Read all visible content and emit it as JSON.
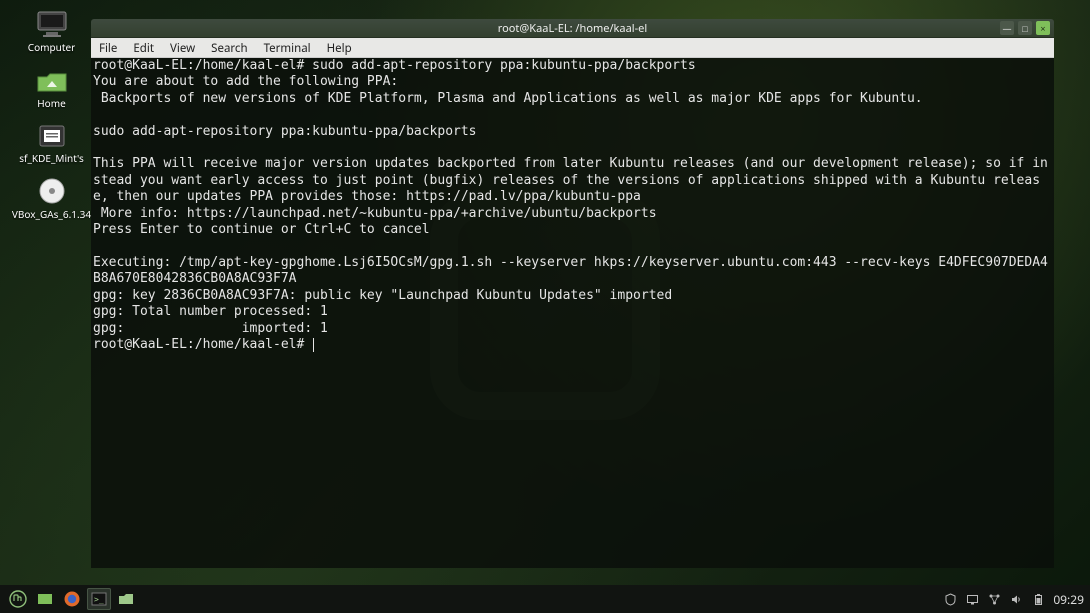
{
  "desktop_icons": [
    {
      "name": "computer",
      "label": "Computer"
    },
    {
      "name": "home",
      "label": "Home"
    },
    {
      "name": "shared",
      "label": "sf_KDE_Mint's"
    },
    {
      "name": "vbox-ga",
      "label": "VBox_GAs_6.1.34"
    }
  ],
  "window": {
    "title": "root@KaaL-EL: /home/kaal-el",
    "menu": [
      "File",
      "Edit",
      "View",
      "Search",
      "Terminal",
      "Help"
    ],
    "buttons": {
      "min": "—",
      "max": "□",
      "close": "×"
    }
  },
  "terminal": {
    "lines": [
      "root@KaaL-EL:/home/kaal-el# sudo add-apt-repository ppa:kubuntu-ppa/backports",
      "You are about to add the following PPA:",
      " Backports of new versions of KDE Platform, Plasma and Applications as well as major KDE apps for Kubuntu.",
      "",
      "sudo add-apt-repository ppa:kubuntu-ppa/backports",
      "",
      "This PPA will receive major version updates backported from later Kubuntu releases (and our development release); so if instead you want early access to just point (bugfix) releases of the versions of applications shipped with a Kubuntu release, then our updates PPA provides those: https://pad.lv/ppa/kubuntu-ppa",
      " More info: https://launchpad.net/~kubuntu-ppa/+archive/ubuntu/backports",
      "Press Enter to continue or Ctrl+C to cancel",
      "",
      "Executing: /tmp/apt-key-gpghome.Lsj6I5OCsM/gpg.1.sh --keyserver hkps://keyserver.ubuntu.com:443 --recv-keys E4DFEC907DEDA4B8A670E8042836CB0A8AC93F7A",
      "gpg: key 2836CB0A8AC93F7A: public key \"Launchpad Kubuntu Updates\" imported",
      "gpg: Total number processed: 1",
      "gpg:               imported: 1",
      "root@KaaL-EL:/home/kaal-el# "
    ]
  },
  "panel": {
    "tasks": [
      {
        "name": "menu",
        "active": false
      },
      {
        "name": "files",
        "active": false
      },
      {
        "name": "firefox",
        "active": false
      },
      {
        "name": "terminal",
        "active": true
      },
      {
        "name": "folders",
        "active": false
      }
    ],
    "tray": [
      {
        "name": "shield-icon"
      },
      {
        "name": "display-icon"
      },
      {
        "name": "network-icon"
      },
      {
        "name": "volume-icon"
      },
      {
        "name": "battery-icon"
      }
    ],
    "clock": "09:29"
  }
}
